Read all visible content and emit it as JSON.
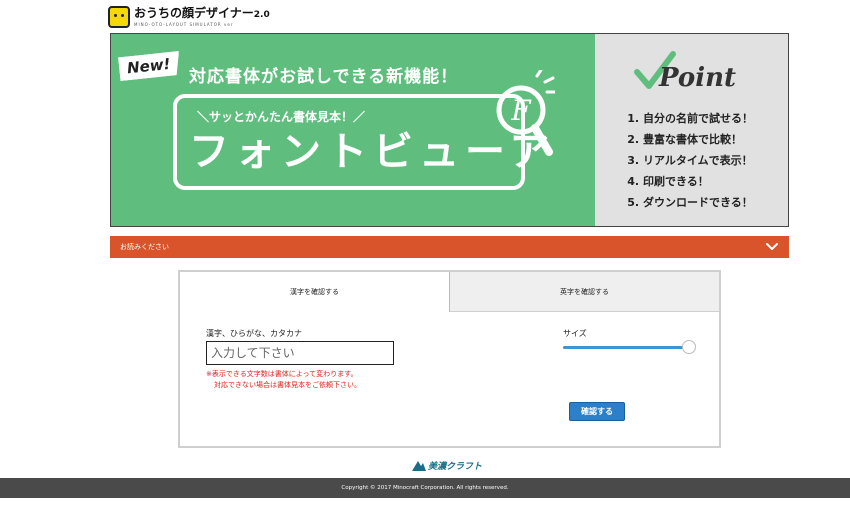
{
  "header": {
    "logo_title": "おうちの顔デザイナー",
    "logo_version": "2.0",
    "logo_subtitle": "MINO-OTO-LAYOUT SIMULATOR ver"
  },
  "banner": {
    "new_badge": "New!",
    "headline": "対応書体がお試しできる新機能！",
    "subline": "＼サッとかんたん書体見本！／",
    "title": "フォントビューア",
    "magnifier_letter": "F",
    "point_label": "Point",
    "points": [
      "1. 自分の名前で試せる！",
      "2. 豊富な書体で比較！",
      "3. リアルタイムで表示！",
      "4. 印刷できる！",
      "5. ダウンロードできる！"
    ],
    "colors": {
      "green": "#5fbe7d",
      "gray": "#e1e1e1"
    }
  },
  "notice": {
    "label": "お読みください",
    "color": "#d9542b"
  },
  "tabs": [
    {
      "label": "漢字を確認する",
      "active": true
    },
    {
      "label": "英字を確認する",
      "active": false
    }
  ],
  "form": {
    "field_label": "漢字、ひらがな、カタカナ",
    "input_placeholder": "入力して下さい",
    "input_value": "",
    "warning_line1": "※表示できる文字数は書体によって変わります。",
    "warning_line2": "対応できない場合は書体見本をご依頼下さい。",
    "size_label": "サイズ",
    "size_value_percent": 100,
    "confirm_button": "確認する"
  },
  "footer": {
    "brand": "美濃クラフト",
    "copyright": "Copyright © 2017 Minocraft Corporation. All rights reserved."
  }
}
